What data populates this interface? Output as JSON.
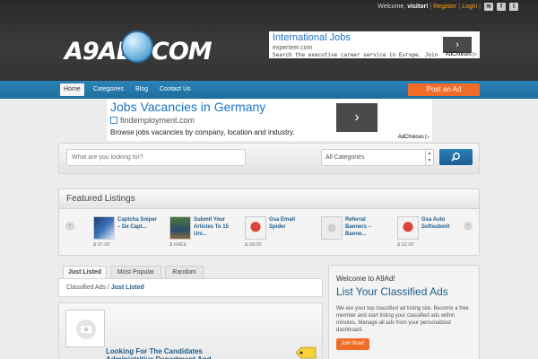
{
  "header": {
    "welcome_prefix": "Welcome,",
    "username": "visitor!",
    "register": "Register",
    "separator": "|",
    "login": "Login",
    "logo_left": "A9AD",
    "logo_right": "COM",
    "social_icons": [
      "rss-icon",
      "facebook-icon",
      "twitter-icon"
    ]
  },
  "ad_top": {
    "title": "International Jobs",
    "domain": "experteer.com",
    "snippet": "Search the executive career service in Europe. Join",
    "adchoices": "AdChoices ▷",
    "arrow": "›"
  },
  "nav": {
    "items": [
      "Home",
      "Categories",
      "Blog",
      "Contact Us"
    ],
    "post_ad": "Post an Ad"
  },
  "ad_mid": {
    "title": "Jobs Vacancies in Germany",
    "domain": "findemployment.com",
    "snippet": "Browse jobs vacancies by company, location and industry.",
    "adchoices": "AdChoices ▷",
    "arrow": "›"
  },
  "search": {
    "placeholder": "What are you looking for?",
    "category": "All Categories"
  },
  "featured": {
    "heading": "Featured Listings",
    "listings": [
      {
        "title": "Captcha Sniper – De Capt...",
        "price": "$ 97.00"
      },
      {
        "title": "Submit Your Articles To 15 Uni...",
        "price": "$ FREE"
      },
      {
        "title": "Gsa Email Spider",
        "price": "$ 99.00"
      },
      {
        "title": "Referral Banners – Banne...",
        "price": ""
      },
      {
        "title": "Gsa Auto Softsubmit",
        "price": "$ 52.00"
      }
    ]
  },
  "tabs": [
    "Just Listed",
    "Most Popular",
    "Random"
  ],
  "breadcrumb": {
    "root": "Classified Ads",
    "sep": "/",
    "current": "Just Listed"
  },
  "latest": {
    "title": "Looking For The Candidates Administritive Department And"
  },
  "welcome_box": {
    "title": "Welcome to A9Ad!",
    "headline": "List Your Classified Ads",
    "description": "We are your top classified ad listing site. Become a free member and start listing your classified ads within minutes. Manage all ads from your personalized dashboard.",
    "join": "Join Now!"
  },
  "colors": {
    "nav_blue": "#1f6d9e",
    "accent_orange": "#f06c28",
    "link_blue": "#1f5c8a"
  }
}
